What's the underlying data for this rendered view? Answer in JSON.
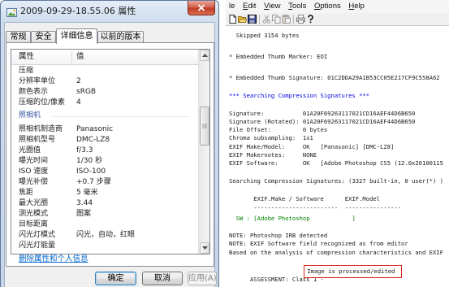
{
  "colors": {
    "section_header_blue": "#0000e0",
    "signature_green": "#008000",
    "assessment_box_red": "#d9261c",
    "link_blue": "#0066cc",
    "camera_group_blue": "#3b58a6",
    "close_button_red": "#c13b25"
  },
  "left_dialog": {
    "icon": "image-file-icon",
    "title": "2009-09-29-18.55.06 属性",
    "close_icon": "close-icon",
    "tabs": [
      {
        "label": "常规",
        "selected": false
      },
      {
        "label": "安全",
        "selected": false
      },
      {
        "label": "详细信息",
        "selected": true
      },
      {
        "label": "以前的版本",
        "selected": false
      }
    ],
    "details": {
      "headers": {
        "property": "属性",
        "value": "值"
      },
      "rows": [
        {
          "property": "压缩",
          "value": ""
        },
        {
          "property": "分辨率单位",
          "value": "2"
        },
        {
          "property": "颜色表示",
          "value": "sRGB"
        },
        {
          "property": "压缩的位/像素",
          "value": "4"
        },
        {
          "group": "照相机"
        },
        {
          "property": "照相机制造商",
          "value": "Panasonic"
        },
        {
          "property": "照相机型号",
          "value": "DMC-LZ8"
        },
        {
          "property": "光圈值",
          "value": "f/3.3"
        },
        {
          "property": "曝光时间",
          "value": "1/30 秒"
        },
        {
          "property": "ISO 速度",
          "value": "ISO-100"
        },
        {
          "property": "曝光补偿",
          "value": "+0.7 步骤"
        },
        {
          "property": "焦距",
          "value": "5 毫米"
        },
        {
          "property": "最大光圈",
          "value": "3.44"
        },
        {
          "property": "测光模式",
          "value": "图案"
        },
        {
          "property": "目标距离",
          "value": ""
        },
        {
          "property": "闪光灯模式",
          "value": "闪光，自动，红眼"
        },
        {
          "property": "闪光灯能量",
          "value": ""
        }
      ]
    },
    "remove_properties_link": "删除属性和个人信息",
    "buttons": {
      "ok": "确定",
      "cancel": "取消",
      "apply": "应用(A)"
    }
  },
  "right_window": {
    "menu": [
      {
        "label": "le"
      },
      {
        "label": "Edit"
      },
      {
        "label": "View"
      },
      {
        "label": "Tools"
      },
      {
        "label": "Options"
      },
      {
        "label": "Help"
      }
    ],
    "toolbar_icons": [
      "new-document-icon",
      "open-folder-icon",
      "save-icon",
      "cut-icon",
      "copy-icon",
      "paste-icon",
      "print-icon",
      "help-icon"
    ],
    "output": {
      "lines": [
        "  Skipped 3154 bytes",
        "* Embedded Thumb Marker: EOI",
        "* Embedded Thumb Signature: 01C2DDA29A1B53CC05E217CF9C558A62",
        "*** Searching Compression Signatures ***",
        "Signature:           01A20F69263117021CD16AEF44D6B650",
        "Signature (Rotated): 01A20F69263117021CD16AEF44D6B650",
        "File Offset:         0 bytes",
        "Chroma subsampling:  1x1",
        "EXIF Make/Model:     OK   [Panasonic] [DMC-LZ8]",
        "EXIF Makernotes:     NONE",
        "EXIF Software:       OK   [Adobe Photoshop CS5 (12.0x20100115",
        "Searching Compression Signatures: (3327 built-in, 0 user(*) )",
        "       EXIF.Make / Software      EXIF.Model",
        "       ------------------------  ----------------",
        "  SW : [Adobe Photoshop            ]",
        "NOTE: Photoshop IRB detected",
        "NOTE: EXIF Software field recognized as from editor",
        "Based on the analysis of compression characteristics and EXIF"
      ],
      "assessment": {
        "prefix": "ASSESSMENT: Class 1 - ",
        "result": "Image is processed/edited"
      }
    }
  }
}
